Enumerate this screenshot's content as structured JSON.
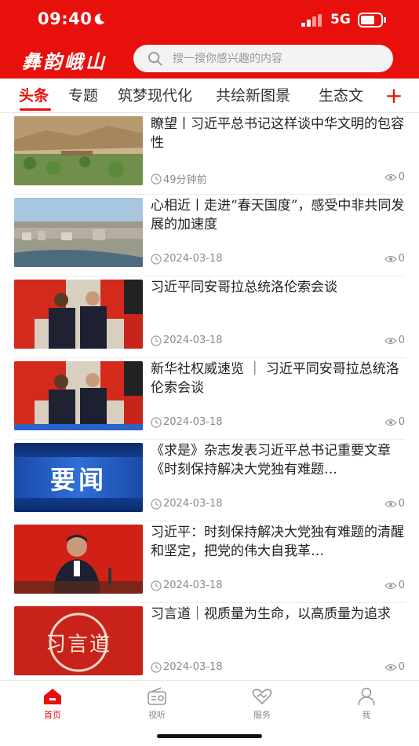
{
  "status_bar": {
    "time": "09:40",
    "network": "5G"
  },
  "header": {
    "app_name": "彝韵峨山"
  },
  "search": {
    "placeholder": "搜一搜你感兴趣的内容"
  },
  "tabs": [
    {
      "label": "头条"
    },
    {
      "label": "专题"
    },
    {
      "label": "筑梦现代化"
    },
    {
      "label": "共绘新图景"
    },
    {
      "label": "生态文"
    }
  ],
  "news": [
    {
      "title": "瞭望丨习近平总书记这样谈中华文明的包容性",
      "time": "49分钟前",
      "views": "0"
    },
    {
      "title": "心相近丨走进“春天国度”，感受中非共同发展的加速度",
      "time": "2024-03-18",
      "views": "0"
    },
    {
      "title": "习近平同安哥拉总统洛伦索会谈",
      "time": "2024-03-18",
      "views": "0"
    },
    {
      "title": "新华社权威速览 ｜ 习近平同安哥拉总统洛伦索会谈",
      "time": "2024-03-18",
      "views": "0"
    },
    {
      "title": "《求是》杂志发表习近平总书记重要文章《时刻保持解决大党独有难题…",
      "time": "2024-03-18",
      "views": "0",
      "thumb_text": "要闻"
    },
    {
      "title": "习近平：时刻保持解决大党独有难题的清醒和坚定，把党的伟大自我革…",
      "time": "2024-03-18",
      "views": "0"
    },
    {
      "title": "习言道｜视质量为生命，以高质量为追求",
      "time": "2024-03-18",
      "views": "0",
      "thumb_text": "习言道"
    }
  ],
  "bottom_nav": [
    {
      "label": "首页",
      "icon": "home-icon",
      "active": true
    },
    {
      "label": "视听",
      "icon": "radio-icon"
    },
    {
      "label": "服务",
      "icon": "service-heart-icon"
    },
    {
      "label": "我",
      "icon": "user-icon"
    }
  ],
  "colors": {
    "brand_red": "#e8100d",
    "meta_gray": "#8a8a8a"
  }
}
